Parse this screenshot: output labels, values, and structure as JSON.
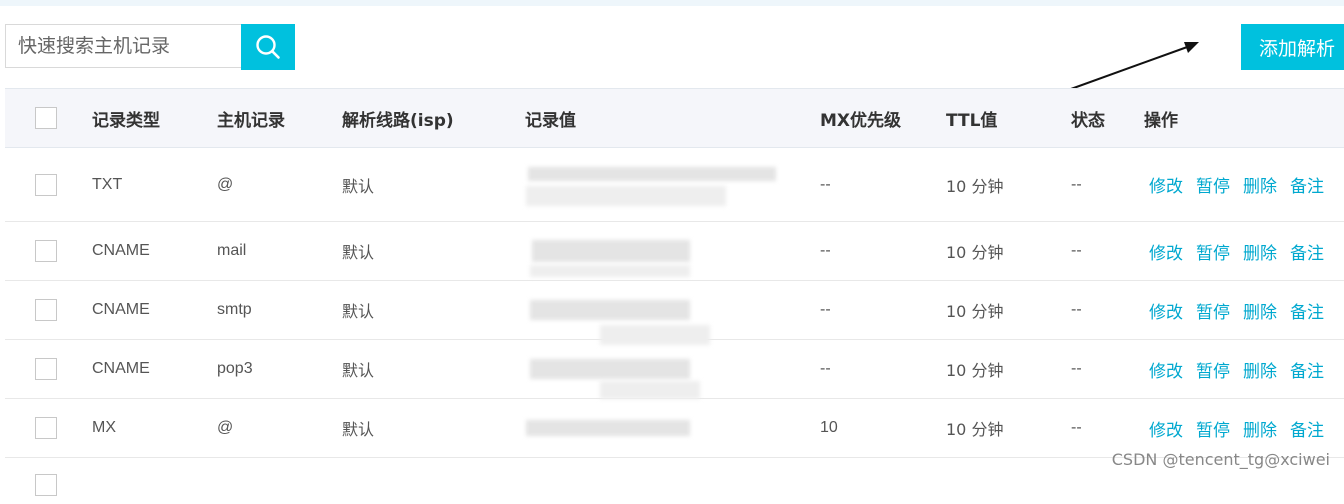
{
  "search": {
    "placeholder": "快速搜索主机记录",
    "icon": "search-icon"
  },
  "add_button": {
    "label": "添加解析"
  },
  "accent_color": "#00c1de",
  "link_color": "#00a8cf",
  "table": {
    "headers": [
      "记录类型",
      "主机记录",
      "解析线路(isp)",
      "记录值",
      "MX优先级",
      "TTL值",
      "状态",
      "操作"
    ],
    "rows": [
      {
        "type": "TXT",
        "host": "@",
        "line": "默认",
        "mx": "--",
        "ttl": "10 分钟",
        "status": "--"
      },
      {
        "type": "CNAME",
        "host": "mail",
        "line": "默认",
        "mx": "--",
        "ttl": "10 分钟",
        "status": "--"
      },
      {
        "type": "CNAME",
        "host": "smtp",
        "line": "默认",
        "mx": "--",
        "ttl": "10 分钟",
        "status": "--"
      },
      {
        "type": "CNAME",
        "host": "pop3",
        "line": "默认",
        "mx": "--",
        "ttl": "10 分钟",
        "status": "--"
      },
      {
        "type": "MX",
        "host": "@",
        "line": "默认",
        "mx": "10",
        "ttl": "10 分钟",
        "status": "--"
      }
    ],
    "actions": [
      "修改",
      "暂停",
      "删除",
      "备注"
    ]
  },
  "watermark": "CSDN @tencent_tg@xciwei"
}
